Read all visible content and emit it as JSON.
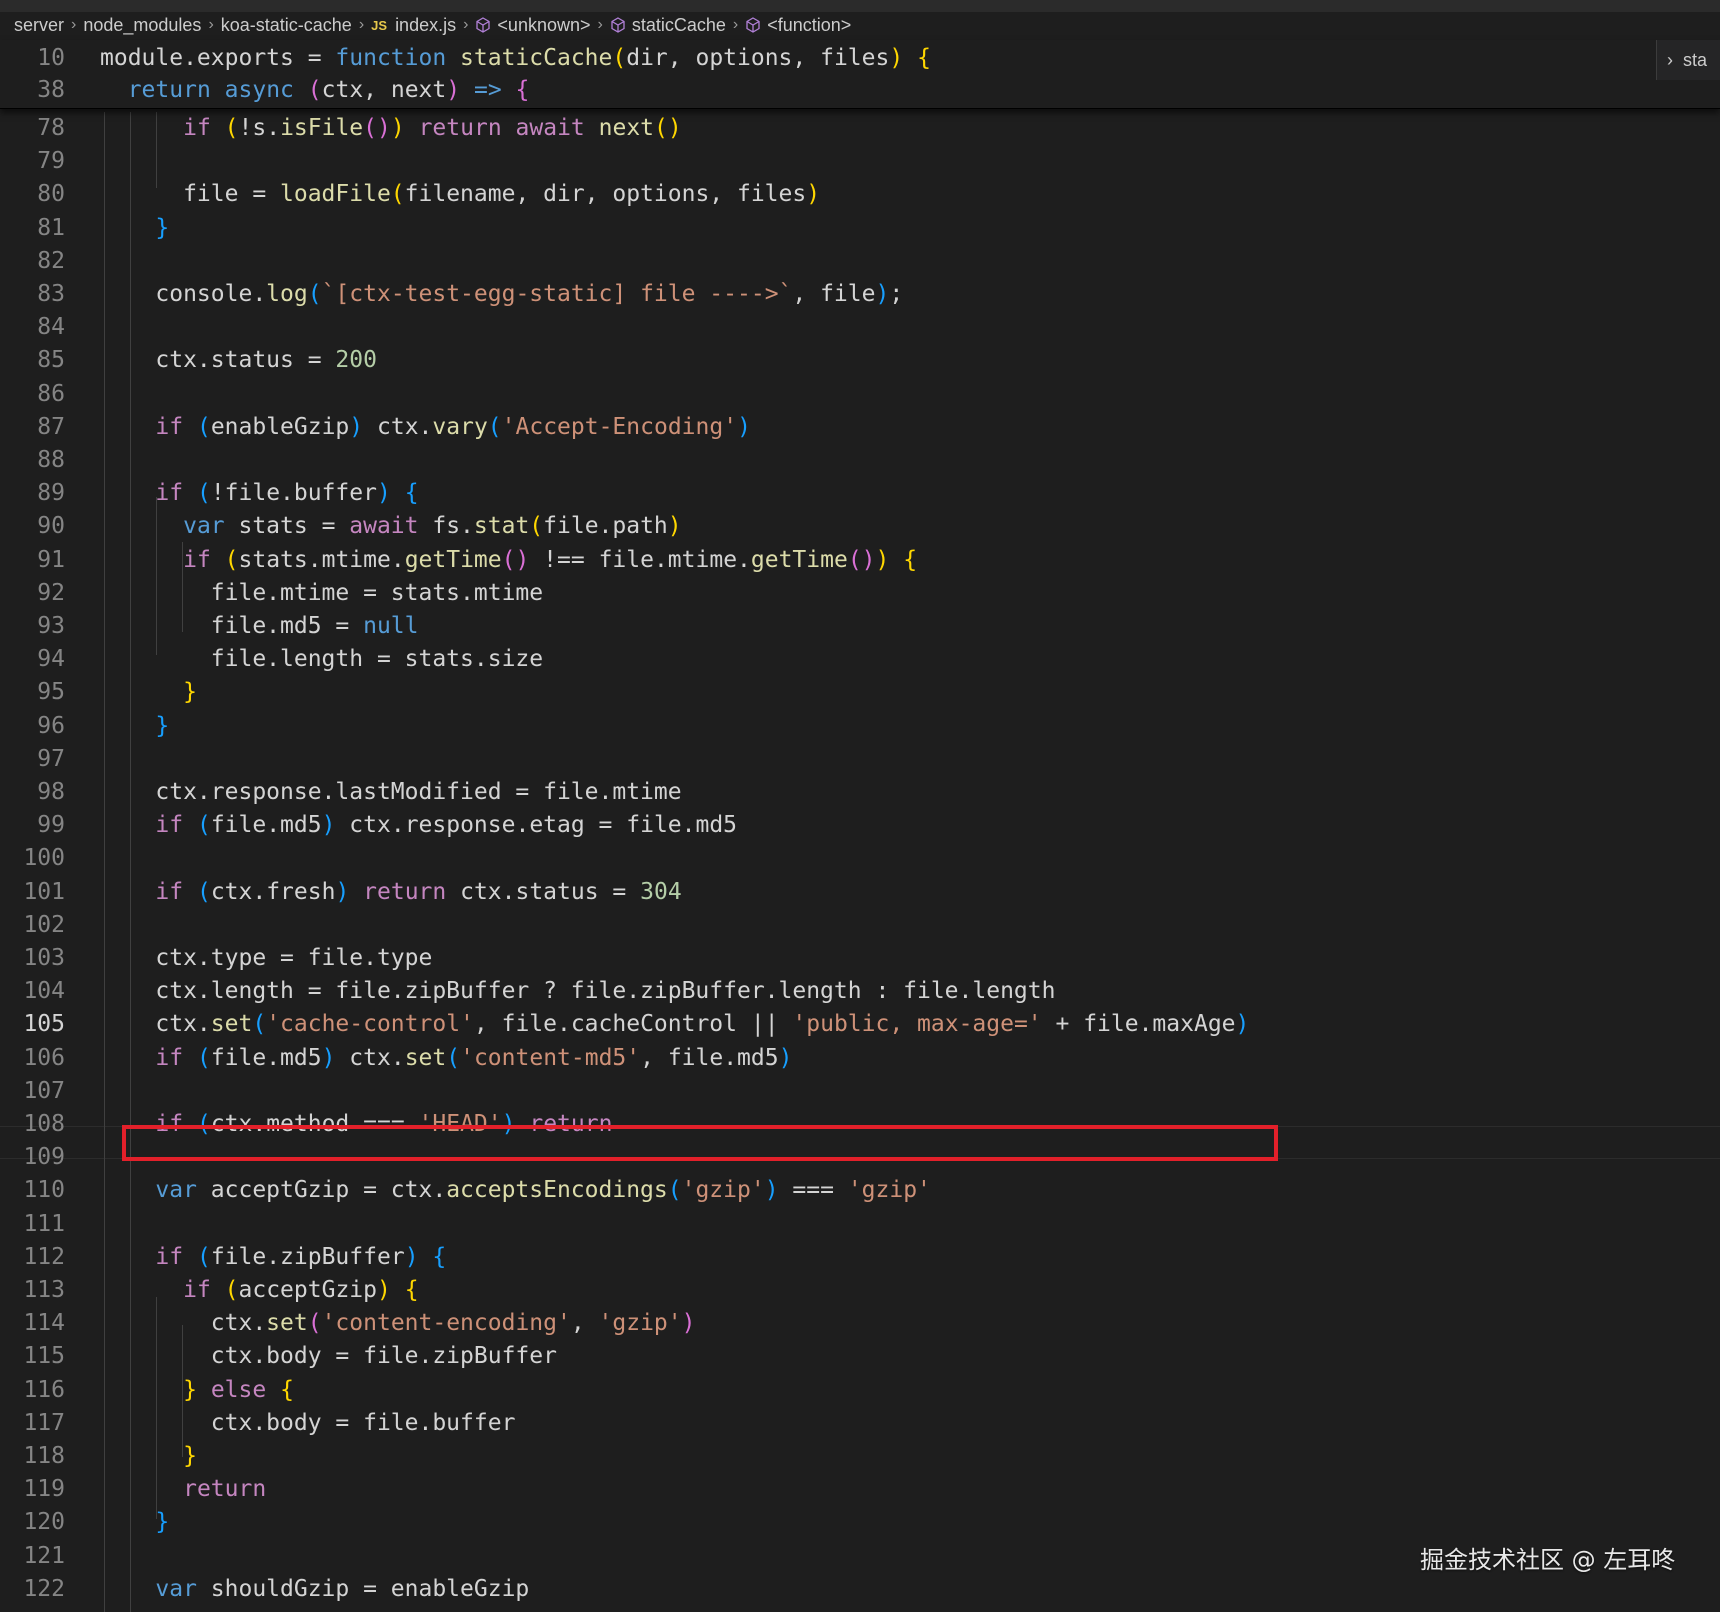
{
  "breadcrumb": {
    "items": [
      {
        "label": "server",
        "icon": ""
      },
      {
        "label": "node_modules",
        "icon": ""
      },
      {
        "label": "koa-static-cache",
        "icon": ""
      },
      {
        "label": "index.js",
        "icon": "js-file-icon",
        "badge": "JS"
      },
      {
        "label": "<unknown>",
        "icon": "symbol-cube-icon"
      },
      {
        "label": "staticCache",
        "icon": "symbol-cube-icon"
      },
      {
        "label": "<function>",
        "icon": "symbol-cube-icon"
      }
    ]
  },
  "outline_peek": {
    "label": "sta"
  },
  "sticky_lines": [
    {
      "num": "10",
      "tokens": [
        [
          "plain",
          "module.exports = "
        ],
        [
          "kw",
          "function"
        ],
        [
          "plain",
          " "
        ],
        [
          "fn",
          "staticCache"
        ],
        [
          "b1",
          "("
        ],
        [
          "plain",
          "dir, options, files"
        ],
        [
          "b1",
          ")"
        ],
        [
          "plain",
          " "
        ],
        [
          "b1",
          "{"
        ]
      ]
    },
    {
      "num": "38",
      "tokens": [
        [
          "plain",
          "  "
        ],
        [
          "kw",
          "return"
        ],
        [
          "plain",
          " "
        ],
        [
          "kw",
          "async"
        ],
        [
          "plain",
          " "
        ],
        [
          "b2",
          "("
        ],
        [
          "plain",
          "ctx, next"
        ],
        [
          "b2",
          ")"
        ],
        [
          "plain",
          " "
        ],
        [
          "kw",
          "=>"
        ],
        [
          "plain",
          " "
        ],
        [
          "b2",
          "{"
        ]
      ]
    }
  ],
  "active_line": "105",
  "lines": [
    {
      "num": "78",
      "tokens": [
        [
          "plain",
          "      "
        ],
        [
          "ctl",
          "if"
        ],
        [
          "plain",
          " "
        ],
        [
          "b1",
          "("
        ],
        [
          "plain",
          "!s."
        ],
        [
          "fn",
          "isFile"
        ],
        [
          "b2",
          "()"
        ],
        [
          "b1",
          ")"
        ],
        [
          "plain",
          " "
        ],
        [
          "ctl",
          "return"
        ],
        [
          "plain",
          " "
        ],
        [
          "ctl",
          "await"
        ],
        [
          "plain",
          " "
        ],
        [
          "fn",
          "next"
        ],
        [
          "b1",
          "()"
        ]
      ]
    },
    {
      "num": "79",
      "tokens": []
    },
    {
      "num": "80",
      "tokens": [
        [
          "plain",
          "      file = "
        ],
        [
          "fn",
          "loadFile"
        ],
        [
          "b1",
          "("
        ],
        [
          "plain",
          "filename, dir, options, files"
        ],
        [
          "b1",
          ")"
        ]
      ]
    },
    {
      "num": "81",
      "tokens": [
        [
          "plain",
          "    "
        ],
        [
          "b3",
          "}"
        ]
      ]
    },
    {
      "num": "82",
      "tokens": []
    },
    {
      "num": "83",
      "tokens": [
        [
          "plain",
          "    console."
        ],
        [
          "fn",
          "log"
        ],
        [
          "b3",
          "("
        ],
        [
          "str",
          "`[ctx-test-egg-static] file ---->`"
        ],
        [
          "plain",
          ", file"
        ],
        [
          "b3",
          ")"
        ],
        [
          "plain",
          ";"
        ]
      ]
    },
    {
      "num": "84",
      "tokens": []
    },
    {
      "num": "85",
      "tokens": [
        [
          "plain",
          "    ctx.status = "
        ],
        [
          "num",
          "200"
        ]
      ]
    },
    {
      "num": "86",
      "tokens": []
    },
    {
      "num": "87",
      "tokens": [
        [
          "plain",
          "    "
        ],
        [
          "ctl",
          "if"
        ],
        [
          "plain",
          " "
        ],
        [
          "b3",
          "("
        ],
        [
          "plain",
          "enableGzip"
        ],
        [
          "b3",
          ")"
        ],
        [
          "plain",
          " ctx."
        ],
        [
          "fn",
          "vary"
        ],
        [
          "b3",
          "("
        ],
        [
          "str",
          "'Accept-Encoding'"
        ],
        [
          "b3",
          ")"
        ]
      ]
    },
    {
      "num": "88",
      "tokens": []
    },
    {
      "num": "89",
      "tokens": [
        [
          "plain",
          "    "
        ],
        [
          "ctl",
          "if"
        ],
        [
          "plain",
          " "
        ],
        [
          "b3",
          "("
        ],
        [
          "plain",
          "!file.buffer"
        ],
        [
          "b3",
          ")"
        ],
        [
          "plain",
          " "
        ],
        [
          "b3",
          "{"
        ]
      ]
    },
    {
      "num": "90",
      "tokens": [
        [
          "plain",
          "      "
        ],
        [
          "kw",
          "var"
        ],
        [
          "plain",
          " stats = "
        ],
        [
          "ctl",
          "await"
        ],
        [
          "plain",
          " fs."
        ],
        [
          "fn",
          "stat"
        ],
        [
          "b1",
          "("
        ],
        [
          "plain",
          "file.path"
        ],
        [
          "b1",
          ")"
        ]
      ]
    },
    {
      "num": "91",
      "tokens": [
        [
          "plain",
          "      "
        ],
        [
          "ctl",
          "if"
        ],
        [
          "plain",
          " "
        ],
        [
          "b1",
          "("
        ],
        [
          "plain",
          "stats.mtime."
        ],
        [
          "fn",
          "getTime"
        ],
        [
          "b2",
          "()"
        ],
        [
          "plain",
          " !== file.mtime."
        ],
        [
          "fn",
          "getTime"
        ],
        [
          "b2",
          "()"
        ],
        [
          "b1",
          ")"
        ],
        [
          "plain",
          " "
        ],
        [
          "b1",
          "{"
        ]
      ]
    },
    {
      "num": "92",
      "tokens": [
        [
          "plain",
          "        file.mtime = stats.mtime"
        ]
      ]
    },
    {
      "num": "93",
      "tokens": [
        [
          "plain",
          "        file.md5 = "
        ],
        [
          "kw",
          "null"
        ]
      ]
    },
    {
      "num": "94",
      "tokens": [
        [
          "plain",
          "        file.length = stats.size"
        ]
      ]
    },
    {
      "num": "95",
      "tokens": [
        [
          "plain",
          "      "
        ],
        [
          "b1",
          "}"
        ]
      ]
    },
    {
      "num": "96",
      "tokens": [
        [
          "plain",
          "    "
        ],
        [
          "b3",
          "}"
        ]
      ]
    },
    {
      "num": "97",
      "tokens": []
    },
    {
      "num": "98",
      "tokens": [
        [
          "plain",
          "    ctx.response.lastModified = file.mtime"
        ]
      ]
    },
    {
      "num": "99",
      "tokens": [
        [
          "plain",
          "    "
        ],
        [
          "ctl",
          "if"
        ],
        [
          "plain",
          " "
        ],
        [
          "b3",
          "("
        ],
        [
          "plain",
          "file.md5"
        ],
        [
          "b3",
          ")"
        ],
        [
          "plain",
          " ctx.response.etag = file.md5"
        ]
      ]
    },
    {
      "num": "100",
      "tokens": []
    },
    {
      "num": "101",
      "tokens": [
        [
          "plain",
          "    "
        ],
        [
          "ctl",
          "if"
        ],
        [
          "plain",
          " "
        ],
        [
          "b3",
          "("
        ],
        [
          "plain",
          "ctx.fresh"
        ],
        [
          "b3",
          ")"
        ],
        [
          "plain",
          " "
        ],
        [
          "ctl",
          "return"
        ],
        [
          "plain",
          " ctx.status = "
        ],
        [
          "num",
          "304"
        ]
      ]
    },
    {
      "num": "102",
      "tokens": []
    },
    {
      "num": "103",
      "tokens": [
        [
          "plain",
          "    ctx.type = file.type"
        ]
      ]
    },
    {
      "num": "104",
      "tokens": [
        [
          "plain",
          "    ctx.length = file.zipBuffer ? file.zipBuffer.length : file.length"
        ]
      ]
    },
    {
      "num": "105",
      "tokens": [
        [
          "plain",
          "    ctx."
        ],
        [
          "fn",
          "set"
        ],
        [
          "b3",
          "("
        ],
        [
          "str",
          "'cache-control'"
        ],
        [
          "plain",
          ", file.cacheControl || "
        ],
        [
          "str",
          "'public, max-age='"
        ],
        [
          "plain",
          " + file.maxAge"
        ],
        [
          "b3",
          ")"
        ]
      ]
    },
    {
      "num": "106",
      "tokens": [
        [
          "plain",
          "    "
        ],
        [
          "ctl",
          "if"
        ],
        [
          "plain",
          " "
        ],
        [
          "b3",
          "("
        ],
        [
          "plain",
          "file.md5"
        ],
        [
          "b3",
          ")"
        ],
        [
          "plain",
          " ctx."
        ],
        [
          "fn",
          "set"
        ],
        [
          "b3",
          "("
        ],
        [
          "str",
          "'content-md5'"
        ],
        [
          "plain",
          ", file.md5"
        ],
        [
          "b3",
          ")"
        ]
      ]
    },
    {
      "num": "107",
      "tokens": []
    },
    {
      "num": "108",
      "tokens": [
        [
          "plain",
          "    "
        ],
        [
          "ctl",
          "if"
        ],
        [
          "plain",
          " "
        ],
        [
          "b3",
          "("
        ],
        [
          "plain",
          "ctx.method === "
        ],
        [
          "str",
          "'HEAD'"
        ],
        [
          "b3",
          ")"
        ],
        [
          "plain",
          " "
        ],
        [
          "ctl",
          "return"
        ]
      ]
    },
    {
      "num": "109",
      "tokens": []
    },
    {
      "num": "110",
      "tokens": [
        [
          "plain",
          "    "
        ],
        [
          "kw",
          "var"
        ],
        [
          "plain",
          " acceptGzip = ctx."
        ],
        [
          "fn",
          "acceptsEncodings"
        ],
        [
          "b3",
          "("
        ],
        [
          "str",
          "'gzip'"
        ],
        [
          "b3",
          ")"
        ],
        [
          "plain",
          " === "
        ],
        [
          "str",
          "'gzip'"
        ]
      ]
    },
    {
      "num": "111",
      "tokens": []
    },
    {
      "num": "112",
      "tokens": [
        [
          "plain",
          "    "
        ],
        [
          "ctl",
          "if"
        ],
        [
          "plain",
          " "
        ],
        [
          "b3",
          "("
        ],
        [
          "plain",
          "file.zipBuffer"
        ],
        [
          "b3",
          ")"
        ],
        [
          "plain",
          " "
        ],
        [
          "b3",
          "{"
        ]
      ]
    },
    {
      "num": "113",
      "tokens": [
        [
          "plain",
          "      "
        ],
        [
          "ctl",
          "if"
        ],
        [
          "plain",
          " "
        ],
        [
          "b1",
          "("
        ],
        [
          "plain",
          "acceptGzip"
        ],
        [
          "b1",
          ")"
        ],
        [
          "plain",
          " "
        ],
        [
          "b1",
          "{"
        ]
      ]
    },
    {
      "num": "114",
      "tokens": [
        [
          "plain",
          "        ctx."
        ],
        [
          "fn",
          "set"
        ],
        [
          "b2",
          "("
        ],
        [
          "str",
          "'content-encoding'"
        ],
        [
          "plain",
          ", "
        ],
        [
          "str",
          "'gzip'"
        ],
        [
          "b2",
          ")"
        ]
      ]
    },
    {
      "num": "115",
      "tokens": [
        [
          "plain",
          "        ctx.body = file.zipBuffer"
        ]
      ]
    },
    {
      "num": "116",
      "tokens": [
        [
          "plain",
          "      "
        ],
        [
          "b1",
          "}"
        ],
        [
          "plain",
          " "
        ],
        [
          "ctl",
          "else"
        ],
        [
          "plain",
          " "
        ],
        [
          "b1",
          "{"
        ]
      ]
    },
    {
      "num": "117",
      "tokens": [
        [
          "plain",
          "        ctx.body = file.buffer"
        ]
      ]
    },
    {
      "num": "118",
      "tokens": [
        [
          "plain",
          "      "
        ],
        [
          "b1",
          "}"
        ]
      ]
    },
    {
      "num": "119",
      "tokens": [
        [
          "plain",
          "      "
        ],
        [
          "ctl",
          "return"
        ]
      ]
    },
    {
      "num": "120",
      "tokens": [
        [
          "plain",
          "    "
        ],
        [
          "b3",
          "}"
        ]
      ]
    },
    {
      "num": "121",
      "tokens": []
    },
    {
      "num": "122",
      "tokens": [
        [
          "plain",
          "    "
        ],
        [
          "kw",
          "var"
        ],
        [
          "plain",
          " shouldGzip = enableGzip"
        ]
      ]
    }
  ],
  "watermark": "掘金技术社区 @ 左耳咚",
  "colors": {
    "highlight_box": "#e3202a",
    "background": "#1e1e1e"
  }
}
